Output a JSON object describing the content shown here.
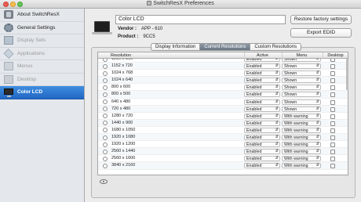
{
  "window": {
    "title": "SwitchResX Preferences"
  },
  "sidebar": {
    "items": [
      {
        "label": "About SwitchResX",
        "icon": "app-icon"
      },
      {
        "label": "General Settings",
        "icon": "gear-icon"
      },
      {
        "label": "Display Sets",
        "icon": "display-sets-icon"
      },
      {
        "label": "Applications",
        "icon": "applications-icon"
      },
      {
        "label": "Menus",
        "icon": "menus-icon"
      },
      {
        "label": "Desktop",
        "icon": "desktop-icon"
      },
      {
        "label": "Color LCD",
        "icon": "monitor-icon"
      }
    ]
  },
  "display": {
    "name": "Color LCD",
    "vendor_label": "Vendor :",
    "vendor_value": "APP - 610",
    "product_label": "Product :",
    "product_value": "9CC5",
    "restore_button": "Restore factory settings",
    "export_button": "Export EDID"
  },
  "tabs": [
    {
      "label": "Display Information",
      "active": false
    },
    {
      "label": "Current Resolutions",
      "active": true
    },
    {
      "label": "Custom Resolutions",
      "active": false
    }
  ],
  "table": {
    "headers": {
      "resolution": "Resolution",
      "active": "Active",
      "menu": "Menu",
      "desktop": "Desktop"
    },
    "rows": [
      {
        "resolution": "1280 x 800",
        "active": "Enabled",
        "menu": "Shown"
      },
      {
        "resolution": "1152 x 720",
        "active": "Enabled",
        "menu": "Shown"
      },
      {
        "resolution": "1024 x 768",
        "active": "Enabled",
        "menu": "Shown"
      },
      {
        "resolution": "1024 x 640",
        "active": "Enabled",
        "menu": "Shown"
      },
      {
        "resolution": "800 x 600",
        "active": "Enabled",
        "menu": "Shown"
      },
      {
        "resolution": "800 x 500",
        "active": "Enabled",
        "menu": "Shown"
      },
      {
        "resolution": "640 x 480",
        "active": "Enabled",
        "menu": "Shown"
      },
      {
        "resolution": "720 x 480",
        "active": "Enabled",
        "menu": "Shown"
      },
      {
        "resolution": "1280 x 720",
        "active": "Enabled",
        "menu": "With warning"
      },
      {
        "resolution": "1440 x 900",
        "active": "Enabled",
        "menu": "With warning"
      },
      {
        "resolution": "1680 x 1050",
        "active": "Enabled",
        "menu": "With warning"
      },
      {
        "resolution": "1920 x 1080",
        "active": "Enabled",
        "menu": "With warning"
      },
      {
        "resolution": "1920 x 1200",
        "active": "Enabled",
        "menu": "With warning"
      },
      {
        "resolution": "2560 x 1440",
        "active": "Enabled",
        "menu": "With warning"
      },
      {
        "resolution": "2560 x 1600",
        "active": "Enabled",
        "menu": "With warning"
      },
      {
        "resolution": "3840 x 2160",
        "active": "Enabled",
        "menu": "With warning"
      }
    ]
  }
}
